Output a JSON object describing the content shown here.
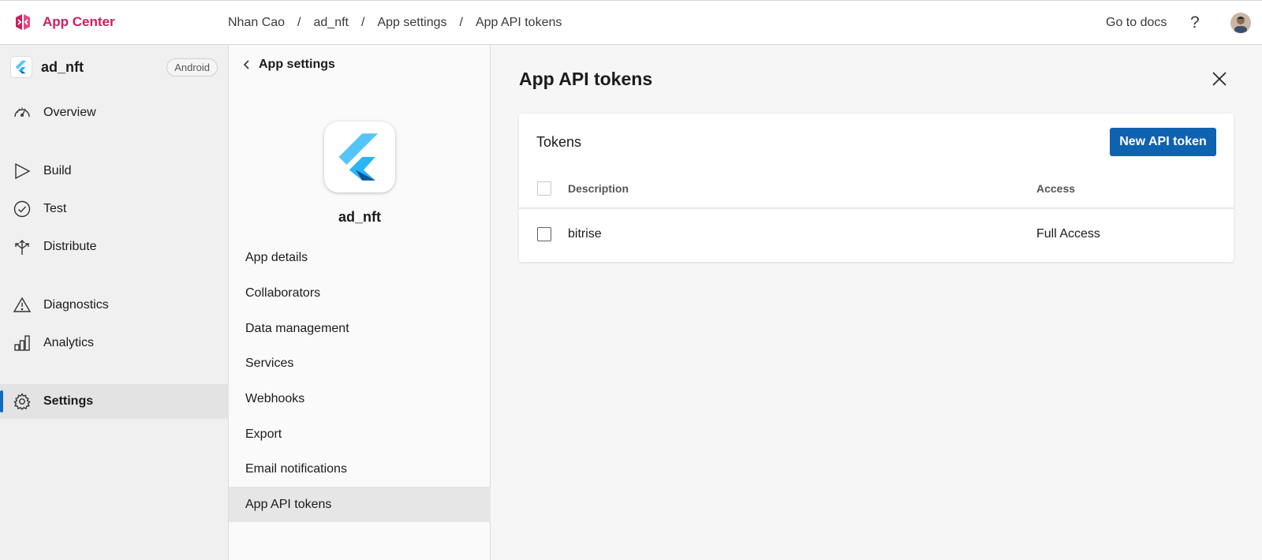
{
  "brand": {
    "name": "App Center",
    "color": "#cc1e5f",
    "icon": "app-center-logo"
  },
  "breadcrumb": [
    "Nhan Cao",
    "ad_nft",
    "App settings",
    "App API tokens"
  ],
  "header": {
    "docs_link": "Go to docs",
    "help_icon": "?"
  },
  "app": {
    "name": "ad_nft",
    "platform": "Android",
    "icon": "flutter-logo"
  },
  "nav": [
    {
      "label": "Overview",
      "icon": "dashboard-gauge-icon"
    },
    {
      "label": "Build",
      "icon": "play-triangle-icon"
    },
    {
      "label": "Test",
      "icon": "check-circle-icon"
    },
    {
      "label": "Distribute",
      "icon": "distribute-arrows-icon"
    },
    {
      "label": "Diagnostics",
      "icon": "warning-triangle-icon"
    },
    {
      "label": "Analytics",
      "icon": "bar-chart-icon"
    },
    {
      "label": "Settings",
      "icon": "gear-icon",
      "active": true
    }
  ],
  "settings": {
    "back_label": "App settings",
    "app_name": "ad_nft",
    "items": [
      {
        "label": "App details"
      },
      {
        "label": "Collaborators"
      },
      {
        "label": "Data management"
      },
      {
        "label": "Services"
      },
      {
        "label": "Webhooks"
      },
      {
        "label": "Export"
      },
      {
        "label": "Email notifications"
      },
      {
        "label": "App API tokens",
        "active": true
      }
    ]
  },
  "main": {
    "title": "App API tokens",
    "card": {
      "title": "Tokens",
      "new_button": "New API token",
      "columns": [
        "Description",
        "Access"
      ],
      "rows": [
        {
          "description": "bitrise",
          "access": "Full Access",
          "checked": false
        }
      ]
    }
  },
  "colors": {
    "accent": "#0f6cbd",
    "button": "#0f62b0"
  }
}
